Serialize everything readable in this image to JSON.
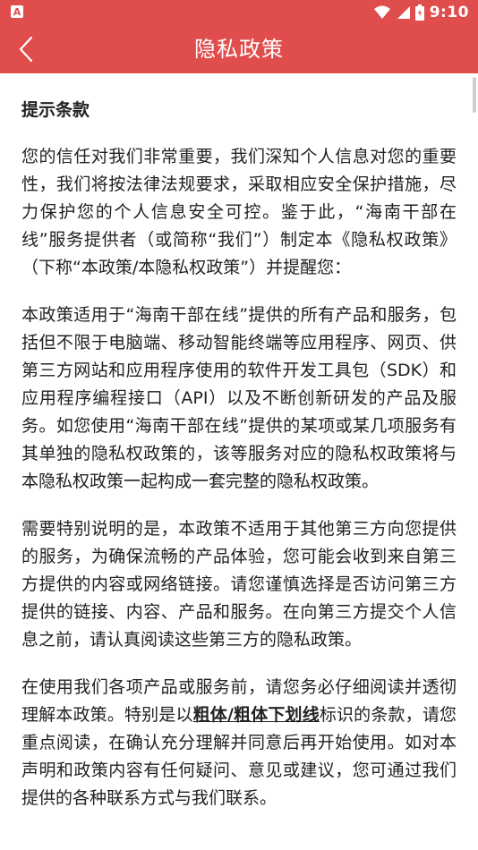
{
  "status_bar": {
    "left_badge": "A",
    "time": "9:10",
    "icons": [
      "wifi-icon",
      "signal-icon",
      "battery-icon"
    ]
  },
  "app_bar": {
    "back_icon": "chevron-left-icon",
    "title": "隐私政策"
  },
  "content": {
    "heading": "提示条款",
    "para1": "您的信任对我们非常重要，我们深知个人信息对您的重要性，我们将按法律法规要求，采取相应安全保护措施，尽力保护您的个人信息安全可控。鉴于此，“海南干部在线”服务提供者（或简称“我们”）制定本《隐私权政策》（下称“本政策/本隐私权政策”）并提醒您：",
    "para2": "本政策适用于“海南干部在线”提供的所有产品和服务，包括但不限于电脑端、移动智能终端等应用程序、网页、供第三方网站和应用程序使用的软件开发工具包（SDK）和应用程序编程接口（API）以及不断创新研发的产品及服务。如您使用“海南干部在线”提供的某项或某几项服务有其单独的隐私权政策的，该等服务对应的隐私权政策将与本隐私权政策一起构成一套完整的隐私权政策。",
    "para3": "需要特别说明的是，本政策不适用于其他第三方向您提供的服务，为确保流畅的产品体验，您可能会收到来自第三方提供的内容或网络链接。请您谨慎选择是否访问第三方提供的链接、内容、产品和服务。在向第三方提交个人信息之前，请认真阅读这些第三方的隐私政策。",
    "para4_a": "在使用我们各项产品或服务前，请您务必仔细阅读并透彻理解本政策。特别是以",
    "para4_bold": "粗体",
    "para4_sep": "/",
    "para4_bold_underline": "粗体下划线",
    "para4_b": "标识的条款，请您重点阅读，在确认充分理解并同意后再开始使用。如对本声明和政策内容有任何疑问、意见或建议，您可通过我们提供的各种联系方式与我们联系。"
  },
  "colors": {
    "brand": "#e04d4d",
    "text": "#222222"
  }
}
